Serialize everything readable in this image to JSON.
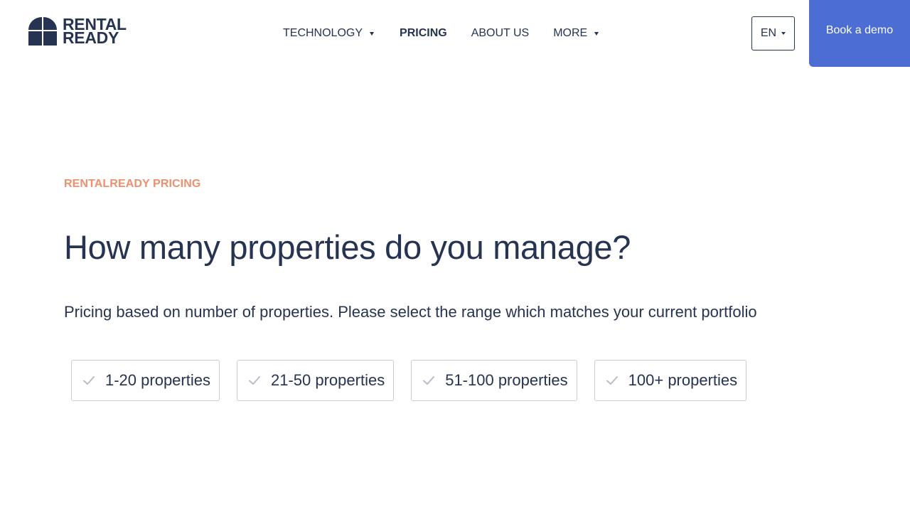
{
  "header": {
    "logo": {
      "line1": "RENTAL",
      "line2": "READY"
    },
    "nav": [
      {
        "label": "TECHNOLOGY",
        "has_dropdown": true,
        "active": false
      },
      {
        "label": "PRICING",
        "has_dropdown": false,
        "active": true
      },
      {
        "label": "ABOUT US",
        "has_dropdown": false,
        "active": false
      },
      {
        "label": "MORE",
        "has_dropdown": true,
        "active": false
      }
    ],
    "language": "EN",
    "cta_label": "Book a demo"
  },
  "hero": {
    "eyebrow": "RENTALREADY PRICING",
    "title": "How many properties do you manage?",
    "subtitle": "Pricing based on number of properties. Please select the range which matches your current portfolio"
  },
  "options": [
    {
      "label": "1-20 properties"
    },
    {
      "label": "21-50 properties"
    },
    {
      "label": "51-100 properties"
    },
    {
      "label": "100+ properties"
    }
  ],
  "colors": {
    "brand_navy": "#263351",
    "accent_blue": "#4b6dd4",
    "eyebrow_coral": "#ee8f6e",
    "check_gray": "#b7bcc6"
  },
  "icons": {
    "logo": "window-arch-logo-icon",
    "dropdown": "caret-down-icon",
    "option": "checkmark-icon"
  }
}
